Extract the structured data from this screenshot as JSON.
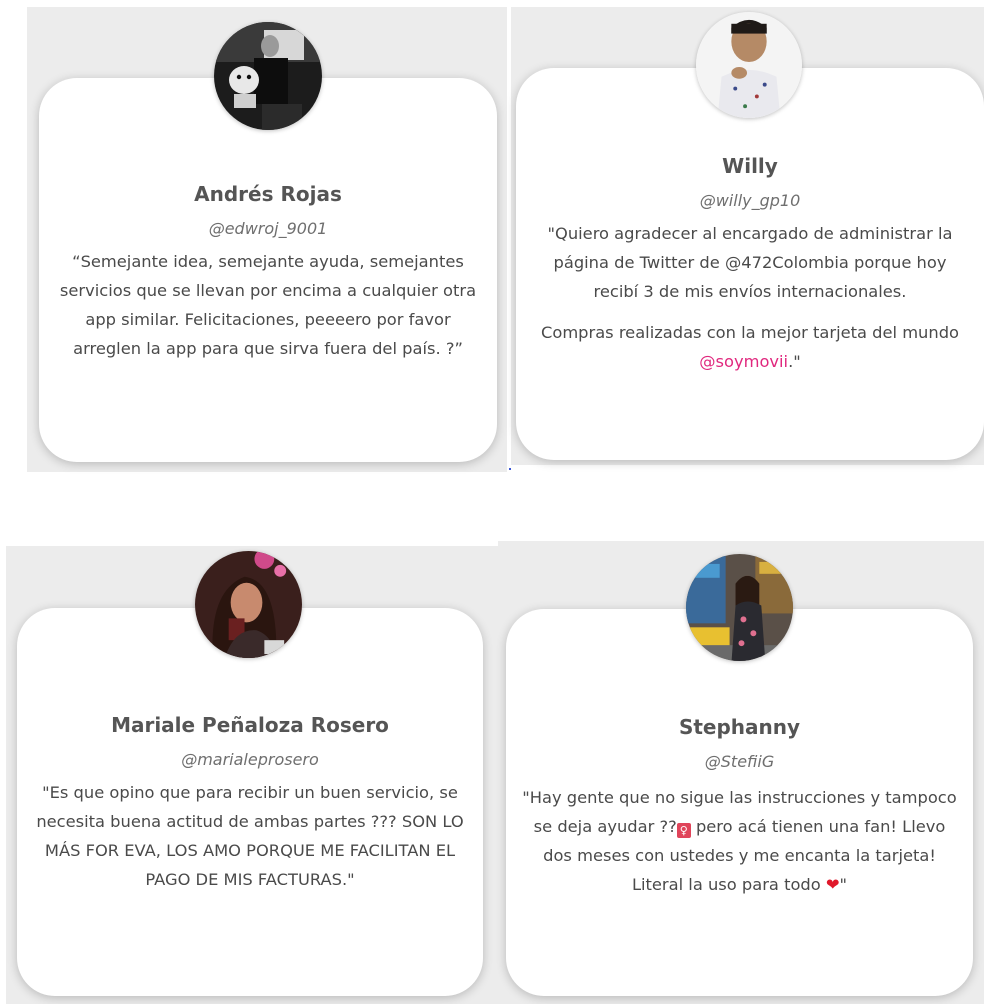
{
  "testimonials": [
    {
      "name": "Andrés Rojas",
      "handle": "@edwroj_9001",
      "quote": "“Semejante idea, semejante ayuda, semejantes servicios que se llevan por encima a cualquier otra app similar. Felicitaciones, peeeero por favor arreglen la app para que sirva fuera del país. ?”"
    },
    {
      "name": "Willy",
      "handle": "@willy_gp10",
      "quote": "\"Quiero agradecer al encargado de administrar la página de Twitter de @472Colombia porque hoy recibí 3 de mis envíos internacionales.",
      "quote2_prefix": "Compras realizadas con la mejor tarjeta del mundo ",
      "quote2_mention": "@soymovii",
      "quote2_suffix": ".\""
    },
    {
      "name": "Mariale Peñaloza Rosero",
      "handle": "@marialeprosero",
      "quote": "\"Es que opino que para recibir un buen servicio, se necesita buena actitud de ambas partes ??? SON LO MÁS FOR EVA, LOS AMO PORQUE ME FACILITAN EL PAGO DE MIS FACTURAS.\""
    },
    {
      "name": "Stephanny",
      "handle": "@StefiiG",
      "quote_part1": "\"Hay gente que no sigue las instrucciones y tampoco se deja ayudar ??",
      "emoji1": "♀",
      "quote_part2": " pero acá tienen una fan! Llevo dos meses con ustedes y me encanta la tarjeta! Literal la uso para todo ",
      "emoji2": "❤",
      "quote_part3": "\""
    }
  ]
}
